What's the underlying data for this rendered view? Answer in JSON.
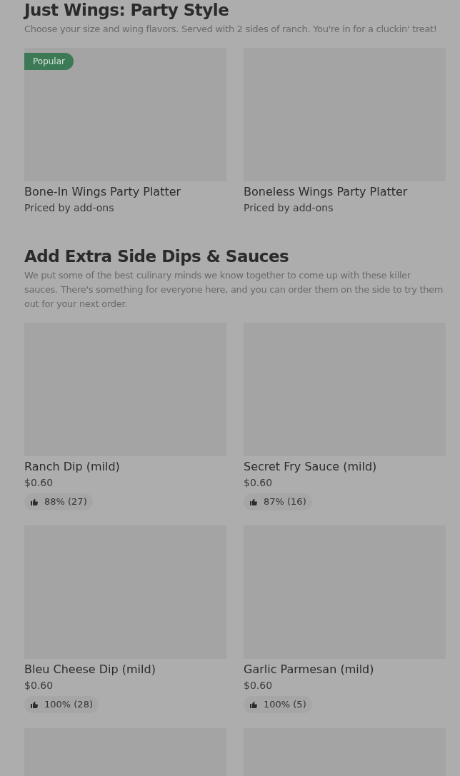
{
  "sections": [
    {
      "title": "Just Wings: Party Style",
      "description": "Choose your size and wing flavors. Served with 2 sides of ranch. You're in for a cluckin' treat!",
      "items": [
        {
          "kind": "item",
          "badge": "Popular",
          "name": "Bone-In Wings Party Platter",
          "price": "Priced by add-ons"
        },
        {
          "kind": "item",
          "name": "Boneless Wings Party Platter",
          "price": "Priced by add-ons"
        }
      ]
    },
    {
      "title": "Add Extra Side Dips & Sauces",
      "description": "We put some of the best culinary minds we know together to come up with these killer sauces. There's something for everyone here, and you can order them on the side to try them out for your next order.",
      "items": [
        {
          "kind": "item",
          "name": "Ranch Dip (mild)",
          "price": "$0.60",
          "rating": "88% (27)"
        },
        {
          "kind": "item",
          "name": "Secret Fry Sauce (mild)",
          "price": "$0.60",
          "rating": "87% (16)"
        },
        {
          "kind": "item",
          "name": "Bleu Cheese Dip (mild)",
          "price": "$0.60",
          "rating": "100% (28)"
        },
        {
          "kind": "item",
          "name": "Garlic Parmesan (mild)",
          "price": "$0.60",
          "rating": "100% (5)"
        },
        {
          "kind": "image_only"
        },
        {
          "kind": "image_only"
        }
      ]
    }
  ]
}
